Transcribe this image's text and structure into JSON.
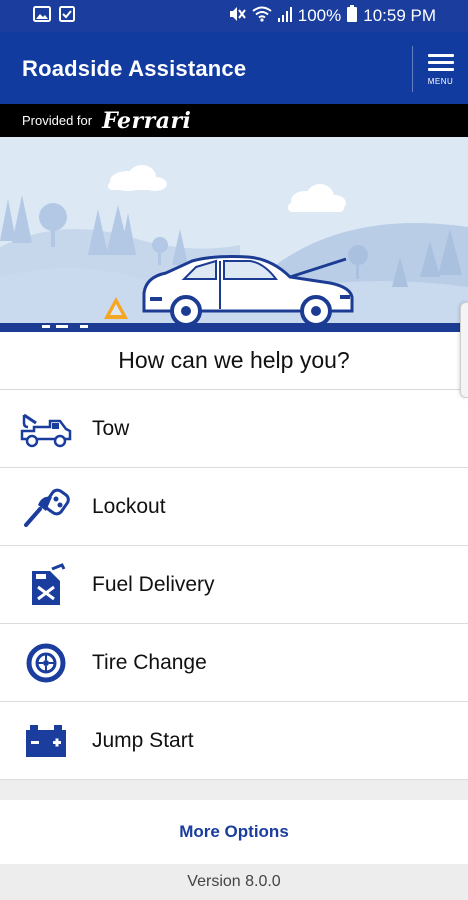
{
  "status_bar": {
    "battery": "100%",
    "time": "10:59 PM"
  },
  "app_bar": {
    "title": "Roadside Assistance",
    "menu_label": "MENU"
  },
  "provided_bar": {
    "text": "Provided for",
    "brand": "Ferrari"
  },
  "help": {
    "heading": "How can we help you?"
  },
  "services": [
    {
      "label": "Tow",
      "icon": "tow-truck-icon"
    },
    {
      "label": "Lockout",
      "icon": "car-key-icon"
    },
    {
      "label": "Fuel Delivery",
      "icon": "fuel-can-icon"
    },
    {
      "label": "Tire Change",
      "icon": "tire-icon"
    },
    {
      "label": "Jump Start",
      "icon": "battery-icon"
    }
  ],
  "footer": {
    "more_options": "More Options",
    "version": "Version 8.0.0"
  },
  "colors": {
    "primary": "#123ba0",
    "status_bar": "#1a3d9e",
    "hero_sky": "#dde8f5",
    "icon_blue": "#1a3d9e",
    "warning_orange": "#f5a623"
  }
}
